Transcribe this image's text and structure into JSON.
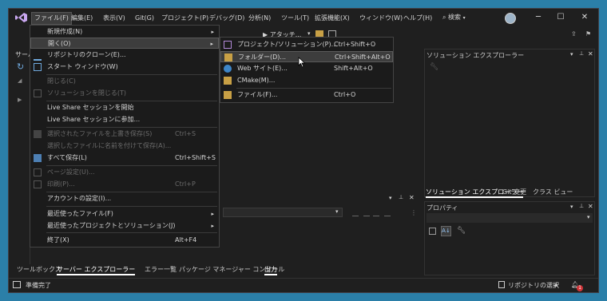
{
  "menubar": [
    "ファイル(F)",
    "編集(E)",
    "表示(V)",
    "Git(G)",
    "プロジェクト(P)",
    "デバッグ(D)",
    "分析(N)",
    "ツール(T)",
    "拡張機能(X)",
    "ウィンドウ(W)",
    "ヘルプ(H)"
  ],
  "search_label": "検索",
  "window_controls": {
    "minimize": "─",
    "maximize": "☐",
    "close": "✕"
  },
  "toolbar": {
    "attach_label": "▶ アタッチ..."
  },
  "left_vtab": "サーバ",
  "file_menu": {
    "items": [
      {
        "label": "新規作成(N)",
        "shortcut": "",
        "arrow": "▸",
        "icon": ""
      },
      {
        "label": "開く(O)",
        "shortcut": "",
        "arrow": "▸",
        "icon": ""
      },
      {
        "label": "リポジトリのクローン(E)...",
        "shortcut": "",
        "arrow": "",
        "icon": "clone-icon"
      },
      {
        "label": "スタート ウィンドウ(W)",
        "shortcut": "",
        "arrow": "",
        "icon": "start-window-icon"
      },
      {
        "label": "閉じる(C)",
        "shortcut": "",
        "arrow": "",
        "icon": ""
      },
      {
        "label": "ソリューションを閉じる(T)",
        "shortcut": "",
        "arrow": "",
        "icon": "close-solution-icon"
      },
      {
        "label": "Live Share セッションを開始",
        "shortcut": "",
        "arrow": "",
        "icon": ""
      },
      {
        "label": "Live Share セッションに参加...",
        "shortcut": "",
        "arrow": "",
        "icon": ""
      },
      {
        "label": "選択されたファイルを上書き保存(S)",
        "shortcut": "Ctrl+S",
        "arrow": "",
        "icon": "save-icon"
      },
      {
        "label": "選択したファイルに名前を付けて保存(A)...",
        "shortcut": "",
        "arrow": "",
        "icon": ""
      },
      {
        "label": "すべて保存(L)",
        "shortcut": "Ctrl+Shift+S",
        "arrow": "",
        "icon": "save-all-icon"
      },
      {
        "label": "ページ設定(U)...",
        "shortcut": "",
        "arrow": "",
        "icon": "page-setup-icon"
      },
      {
        "label": "印刷(P)...",
        "shortcut": "Ctrl+P",
        "arrow": "",
        "icon": "print-icon"
      },
      {
        "label": "アカウントの設定(I)...",
        "shortcut": "",
        "arrow": "",
        "icon": ""
      },
      {
        "label": "最近使ったファイル(F)",
        "shortcut": "",
        "arrow": "▸",
        "icon": ""
      },
      {
        "label": "最近使ったプロジェクトとソリューション(J)",
        "shortcut": "",
        "arrow": "▸",
        "icon": ""
      },
      {
        "label": "終了(X)",
        "shortcut": "Alt+F4",
        "arrow": "",
        "icon": ""
      }
    ]
  },
  "open_submenu": {
    "items": [
      {
        "label": "プロジェクト/ソリューション(P)...",
        "shortcut": "Ctrl+Shift+O"
      },
      {
        "label": "フォルダー(D)...",
        "shortcut": "Ctrl+Shift+Alt+O"
      },
      {
        "label": "Web サイト(E)...",
        "shortcut": "Shift+Alt+O"
      },
      {
        "label": "CMake(M)...",
        "shortcut": ""
      },
      {
        "label": "ファイル(F)...",
        "shortcut": "Ctrl+O"
      }
    ]
  },
  "solution_explorer": {
    "title": "ソリューション エクスプローラー"
  },
  "right_tabs": [
    "ソリューション エクスプローラー",
    "Git 変更",
    "クラス ビュー"
  ],
  "properties": {
    "title": "プロパティ"
  },
  "left_bottom_tabs": [
    "ツールボックス",
    "サーバー エクスプローラー"
  ],
  "bottom_tabs": [
    "エラー一覧",
    "パッケージ マネージャー コンソール",
    "出力"
  ],
  "panel_buttons": {
    "dropdown": "▾",
    "pin": "📌",
    "close": "✕"
  },
  "status": {
    "ready": "準備完了",
    "repo": "リポジトリの選択",
    "repo_arrow": "▲",
    "notif_count": "1"
  }
}
